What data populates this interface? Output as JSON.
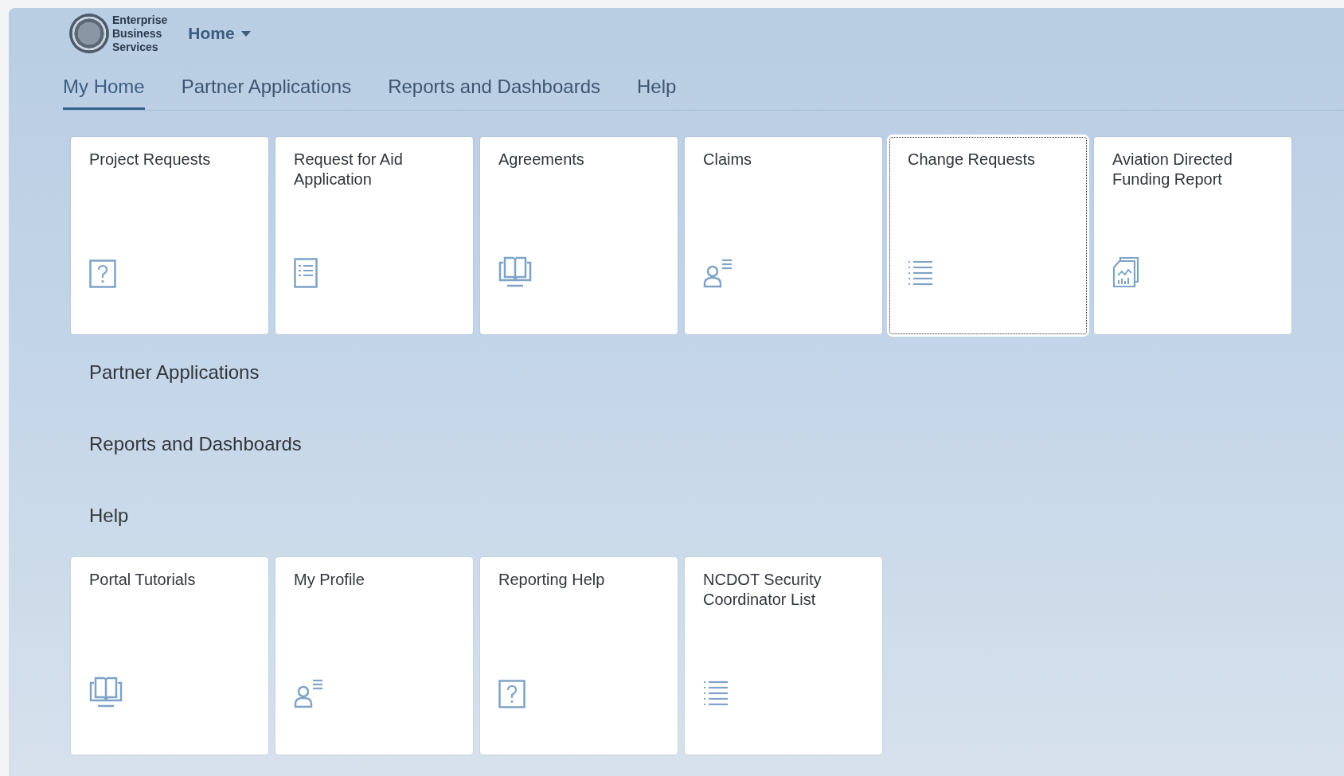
{
  "header": {
    "logo_lines": [
      "Enterprise",
      "Business",
      "Services"
    ],
    "menu_title": "Home"
  },
  "tabs": [
    {
      "label": "My Home",
      "selected": true
    },
    {
      "label": "Partner Applications",
      "selected": false
    },
    {
      "label": "Reports and Dashboards",
      "selected": false
    },
    {
      "label": "Help",
      "selected": false
    }
  ],
  "groups": [
    {
      "tiles": [
        {
          "title": "Project Requests",
          "kind": "question",
          "focused": false
        },
        {
          "title": "Request for Aid Application",
          "kind": "document",
          "focused": false
        },
        {
          "title": "Agreements",
          "kind": "book",
          "focused": false
        },
        {
          "title": "Claims",
          "kind": "person",
          "focused": false
        },
        {
          "title": "Change Requests",
          "kind": "list",
          "focused": true
        },
        {
          "title": "Aviation Directed Funding Report",
          "kind": "report",
          "focused": false
        }
      ]
    },
    {
      "title": "Partner Applications"
    },
    {
      "title": "Reports and Dashboards"
    },
    {
      "title": "Help",
      "tiles": [
        {
          "title": "Portal Tutorials",
          "kind": "book",
          "focused": false
        },
        {
          "title": "My Profile",
          "kind": "person",
          "focused": false
        },
        {
          "title": "Reporting Help",
          "kind": "question",
          "focused": false
        },
        {
          "title": "NCDOT Security Coordinator List",
          "kind": "list",
          "focused": false
        }
      ]
    }
  ]
}
